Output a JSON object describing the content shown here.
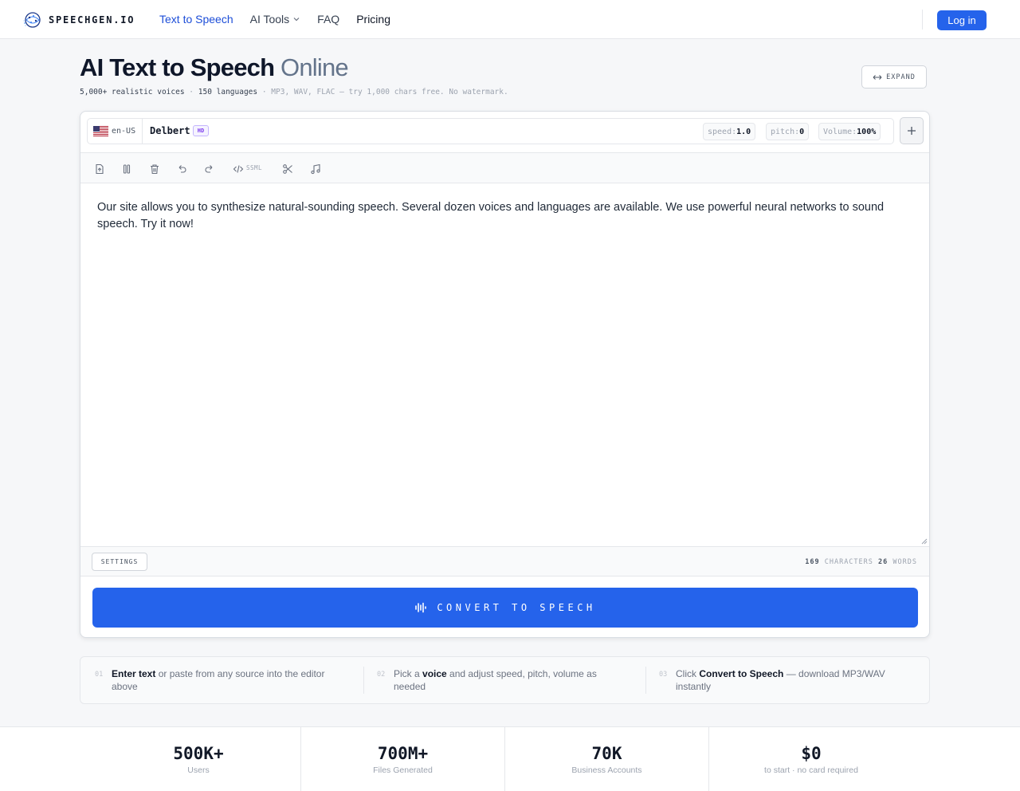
{
  "brand": {
    "name": "SPEECHGEN.IO"
  },
  "nav": {
    "items": [
      {
        "label": "Text to Speech"
      },
      {
        "label": "AI Tools"
      },
      {
        "label": "FAQ"
      },
      {
        "label": "Pricing"
      }
    ],
    "login_label": "Log in"
  },
  "hero": {
    "title_bold": "AI Text to Speech",
    "title_light": "Online",
    "sub_voices": "5,000+ realistic voices",
    "sub_sep1": "·",
    "sub_langs": "150 languages",
    "sub_rest": "· MP3, WAV, FLAC — try 1,000 chars free. No watermark.",
    "expand_label": "EXPAND"
  },
  "editor": {
    "language_code": "en-US",
    "voice_name": "Delbert",
    "voice_badge": "HD",
    "params": {
      "speed_label": "speed:",
      "speed_value": "1.0",
      "pitch_label": "pitch:",
      "pitch_value": "0",
      "volume_label": "Volume:",
      "volume_value": "100%"
    },
    "toolbar": {
      "ssml_label": "SSML"
    },
    "text": "Our site allows you to synthesize natural-sounding speech. Several dozen voices and languages are available. We use powerful neural networks to sound speech. Try it now!",
    "settings_label": "SETTINGS",
    "char_count": "169",
    "char_label": "CHARACTERS",
    "word_count": "26",
    "word_label": "WORDS",
    "convert_label": "CONVERT TO SPEECH"
  },
  "steps": [
    {
      "num": "01",
      "bold": "Enter text",
      "rest": " or paste from any source into the editor above"
    },
    {
      "num": "02",
      "pre": "Pick a ",
      "bold": "voice",
      "rest": " and adjust speed, pitch, volume as needed"
    },
    {
      "num": "03",
      "pre": "Click ",
      "bold": "Convert to Speech",
      "rest": " — download MP3/WAV instantly"
    }
  ],
  "stats": [
    {
      "value": "500K+",
      "label": "Users"
    },
    {
      "value": "700M+",
      "label": "Files Generated"
    },
    {
      "value": "70K",
      "label": "Business Accounts"
    },
    {
      "value": "$0",
      "label": "to start · no card required"
    }
  ],
  "colors": {
    "accent": "#2563eb",
    "accent_dark": "#1d4ed8",
    "badge_purple": "#7c3aed"
  }
}
